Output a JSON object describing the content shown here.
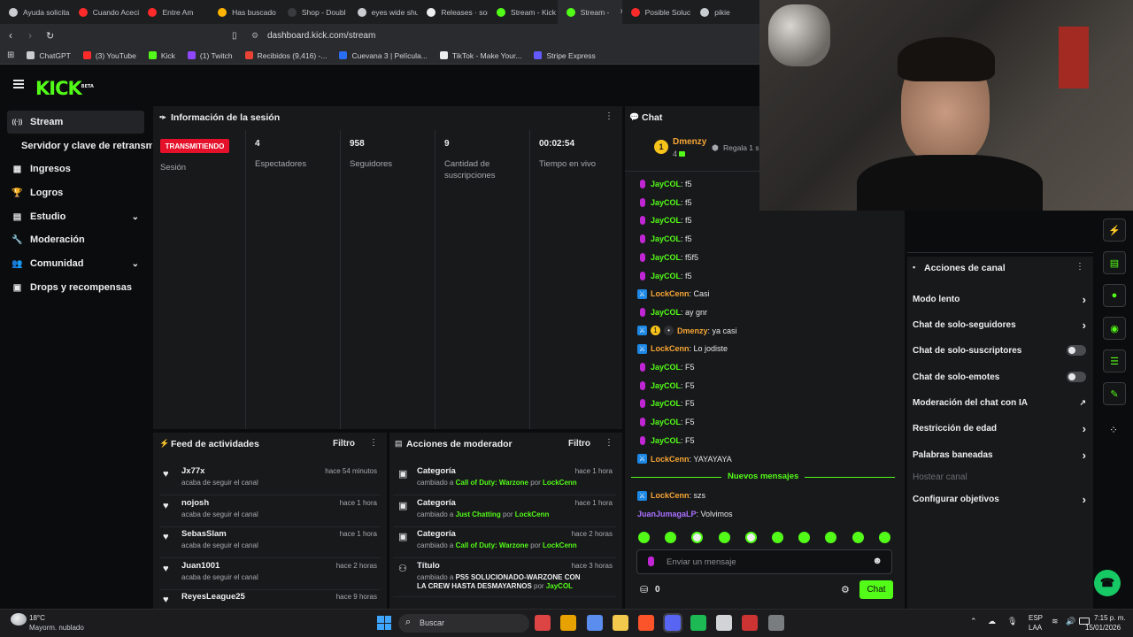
{
  "browser": {
    "tabs": [
      {
        "label": "Ayuda solicita",
        "color": "#c9ccd1"
      },
      {
        "label": "Cuando Aceci",
        "color": "#ff2b2b"
      },
      {
        "label": "Entre Am",
        "color": "#ff2b2b"
      },
      {
        "label": "Has buscado",
        "color": "#ffb400"
      },
      {
        "label": "Shop - Doubl",
        "color": "#3a3b3e"
      },
      {
        "label": "eyes wide shu",
        "color": "#c9ccd1"
      },
      {
        "label": "Releases · sor",
        "color": "#eceef0"
      },
      {
        "label": "Stream - Kick",
        "color": "#53fc18"
      },
      {
        "label": "Stream -",
        "color": "#53fc18"
      },
      {
        "label": "Posible Soluc",
        "color": "#ff2b2b"
      },
      {
        "label": "pikie",
        "color": "#c9ccd1"
      }
    ],
    "close_glyph": "×",
    "url": "dashboard.kick.com/stream",
    "bookmarks": [
      {
        "label": "ChatGPT",
        "color": "#c9ccd1"
      },
      {
        "label": "(3) YouTube",
        "color": "#ff2b2b"
      },
      {
        "label": "Kick",
        "color": "#53fc18"
      },
      {
        "label": "(1) Twitch",
        "color": "#9146ff"
      },
      {
        "label": "Recibidos (9,416) -...",
        "color": "#ea4335"
      },
      {
        "label": "Cuevana 3 | Película...",
        "color": "#2a6ef5"
      },
      {
        "label": "TikTok - Make Your...",
        "color": "#eceef0"
      },
      {
        "label": "Stripe Express",
        "color": "#635bff"
      }
    ]
  },
  "app": {
    "logo": "KICK",
    "beta": "BETA",
    "accent": "#53fc18"
  },
  "sidebar": {
    "items": [
      {
        "label": "Stream",
        "icon": "broadcast-icon",
        "glyph": "((·))",
        "active": true
      },
      {
        "label": "Servidor y clave de retransm",
        "icon": "",
        "glyph": "",
        "sub": true
      },
      {
        "label": "Ingresos",
        "icon": "revenue-icon",
        "glyph": "▦"
      },
      {
        "label": "Logros",
        "icon": "trophy-icon",
        "glyph": "🏆"
      },
      {
        "label": "Estudio",
        "icon": "studio-icon",
        "glyph": "▤",
        "chevron": true
      },
      {
        "label": "Moderación",
        "icon": "wrench-icon",
        "glyph": "🔧"
      },
      {
        "label": "Comunidad",
        "icon": "community-icon",
        "glyph": "👥",
        "chevron": true
      },
      {
        "label": "Drops y recompensas",
        "icon": "drops-icon",
        "glyph": "▣"
      }
    ]
  },
  "session": {
    "title": "Información de la sesión",
    "live_badge": "TRANSMITIENDO",
    "session_label": "Sesión",
    "metrics": [
      {
        "value": "4",
        "label": "Espectadores"
      },
      {
        "value": "958",
        "label": "Seguidores"
      },
      {
        "value": "9",
        "label": "Cantidad de suscripciones"
      },
      {
        "value": "00:02:54",
        "label": "Tiempo en vivo"
      }
    ]
  },
  "feed": {
    "title": "Feed de actividades",
    "filter": "Filtro",
    "rows": [
      {
        "name": "Jx77x",
        "sub": "acaba de seguir el canal",
        "time": "hace 54 minutos"
      },
      {
        "name": "nojosh",
        "sub": "acaba de seguir el canal",
        "time": "hace 1 hora"
      },
      {
        "name": "SebasSlam",
        "sub": "acaba de seguir el canal",
        "time": "hace 1 hora"
      },
      {
        "name": "Juan1001",
        "sub": "acaba de seguir el canal",
        "time": "hace 2 horas"
      },
      {
        "name": "ReyesLeague25",
        "sub": "",
        "time": "hace 9 horas"
      }
    ]
  },
  "mod_actions": {
    "title": "Acciones de moderador",
    "filter": "Filtro",
    "rows": [
      {
        "name": "Categoría",
        "prefix": "cambiado a",
        "value": "Call of Duty: Warzone",
        "by": "por",
        "mod": "LockCenn",
        "time": "hace 1 hora"
      },
      {
        "name": "Categoría",
        "prefix": "cambiado a",
        "value": "Just Chatting",
        "by": "por",
        "mod": "LockCenn",
        "time": "hace 1 hora"
      },
      {
        "name": "Categoría",
        "prefix": "cambiado a",
        "value": "Call of Duty: Warzone",
        "by": "por",
        "mod": "LockCenn",
        "time": "hace 2 horas"
      },
      {
        "name": "Título",
        "prefix": "cambiado a",
        "value": "PS5 SOLUCIONADO-WARZONE CON LA CREW HASTA DESMAYARNOS",
        "by": "por",
        "mod": "JayCOL",
        "time": "hace 3 horas"
      }
    ]
  },
  "chat": {
    "title": "Chat",
    "pinned_user": "Dmenzy",
    "pinned_rank": "1",
    "pinned_count": "4",
    "pinned_action": "Regala 1 su",
    "messages": [
      {
        "user": "JayCOL",
        "text": ": f5",
        "ucolor": "#53fc18",
        "badge": "mic"
      },
      {
        "user": "JayCOL",
        "text": ": f5",
        "ucolor": "#53fc18",
        "badge": "mic"
      },
      {
        "user": "JayCOL",
        "text": ": f5",
        "ucolor": "#53fc18",
        "badge": "mic"
      },
      {
        "user": "JayCOL",
        "text": ": f5",
        "ucolor": "#53fc18",
        "badge": "mic"
      },
      {
        "user": "JayCOL",
        "text": ": f5f5",
        "ucolor": "#53fc18",
        "badge": "mic"
      },
      {
        "user": "JayCOL",
        "text": ": f5",
        "ucolor": "#53fc18",
        "badge": "mic"
      },
      {
        "user": "LockCenn",
        "text": ": Casi",
        "ucolor": "#f7a635",
        "badge": "sword"
      },
      {
        "user": "JayCOL",
        "text": ": ay gnr",
        "ucolor": "#53fc18",
        "badge": "mic"
      },
      {
        "user": "Dmenzy",
        "text": ": ya casi",
        "ucolor": "#f7a635",
        "badge": "sword"
      },
      {
        "user": "LockCenn",
        "text": ": Lo jodiste",
        "ucolor": "#f7a635",
        "badge": "sword"
      },
      {
        "user": "JayCOL",
        "text": ": F5",
        "ucolor": "#53fc18",
        "badge": "mic"
      },
      {
        "user": "JayCOL",
        "text": ": F5",
        "ucolor": "#53fc18",
        "badge": "mic"
      },
      {
        "user": "JayCOL",
        "text": ": F5",
        "ucolor": "#53fc18",
        "badge": "mic"
      },
      {
        "user": "JayCOL",
        "text": ": F5",
        "ucolor": "#53fc18",
        "badge": "mic"
      },
      {
        "user": "JayCOL",
        "text": ": F5",
        "ucolor": "#53fc18",
        "badge": "mic"
      },
      {
        "user": "LockCenn",
        "text": ": YAYAYAYA",
        "ucolor": "#f7a635",
        "badge": "sword"
      }
    ],
    "new_messages": "Nuevos mensajes",
    "after": [
      {
        "user": "LockCenn",
        "text": ": szs",
        "ucolor": "#f7a635",
        "badge": "sword"
      },
      {
        "user": "JuanJumagaLP",
        "text": ": Volvimos",
        "ucolor": "#a970ff",
        "badge": ""
      }
    ],
    "input_placeholder": "Enviar un mensaje",
    "points": "0",
    "send": "Chat"
  },
  "channel_actions": {
    "title": "Acciones de canal",
    "items": [
      {
        "label": "Modo lento",
        "control": "chevron"
      },
      {
        "label": "Chat de solo-seguidores",
        "control": "chevron"
      },
      {
        "label": "Chat de solo-suscriptores",
        "control": "toggle"
      },
      {
        "label": "Chat de solo-emotes",
        "control": "toggle"
      },
      {
        "label": "Moderación del chat con IA",
        "control": "external"
      },
      {
        "label": "Restricción de edad",
        "control": "chevron"
      },
      {
        "label": "Palabras baneadas",
        "control": "chevron"
      },
      {
        "label": "Hostear canal",
        "control": "none",
        "disabled": true
      },
      {
        "label": "Configurar objetivos",
        "control": "chevron"
      }
    ]
  },
  "taskbar": {
    "weather_temp": "18°C",
    "weather_desc": "Mayorm. nublado",
    "search": "Buscar",
    "lang": "ESP",
    "lang_sub": "LAA",
    "time": "7:15 p. m.",
    "date": "15/01/2026"
  }
}
